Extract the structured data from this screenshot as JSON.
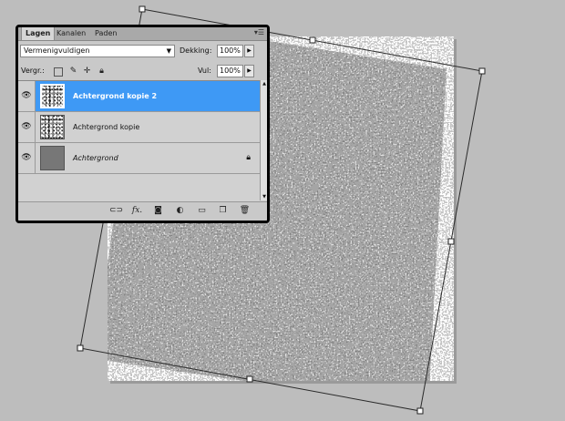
{
  "panel": {
    "tabs": [
      {
        "label": "Lagen",
        "active": true
      },
      {
        "label": "Kanalen",
        "active": false
      },
      {
        "label": "Paden",
        "active": false
      }
    ],
    "menu_icon": "panel-menu-icon",
    "blend_mode": "Vermenigvuldigen",
    "opacity_label": "Dekking:",
    "opacity_value": "100%",
    "lock_label": "Vergr.:",
    "fill_label": "Vul:",
    "fill_value": "100%",
    "lock_icons": [
      "lock-transparency-icon",
      "lock-paint-icon",
      "lock-move-icon",
      "lock-all-icon"
    ],
    "layers": [
      {
        "name": "Achtergrond kopie 2",
        "selected": true,
        "visible": true,
        "thumb": "noise",
        "locked": false,
        "italic": false
      },
      {
        "name": "Achtergrond kopie",
        "selected": false,
        "visible": true,
        "thumb": "noise",
        "locked": false,
        "italic": false
      },
      {
        "name": "Achtergrond",
        "selected": false,
        "visible": true,
        "thumb": "solid",
        "locked": true,
        "italic": true
      }
    ],
    "bottom_icons": [
      "link-layers-icon",
      "fx-icon",
      "add-mask-icon",
      "adjustment-layer-icon",
      "new-group-icon",
      "new-layer-icon",
      "trash-icon"
    ]
  },
  "colors": {
    "workspace": "#bdbdbd",
    "selection": "#3e99f5",
    "panel": "#c9c9c9"
  }
}
